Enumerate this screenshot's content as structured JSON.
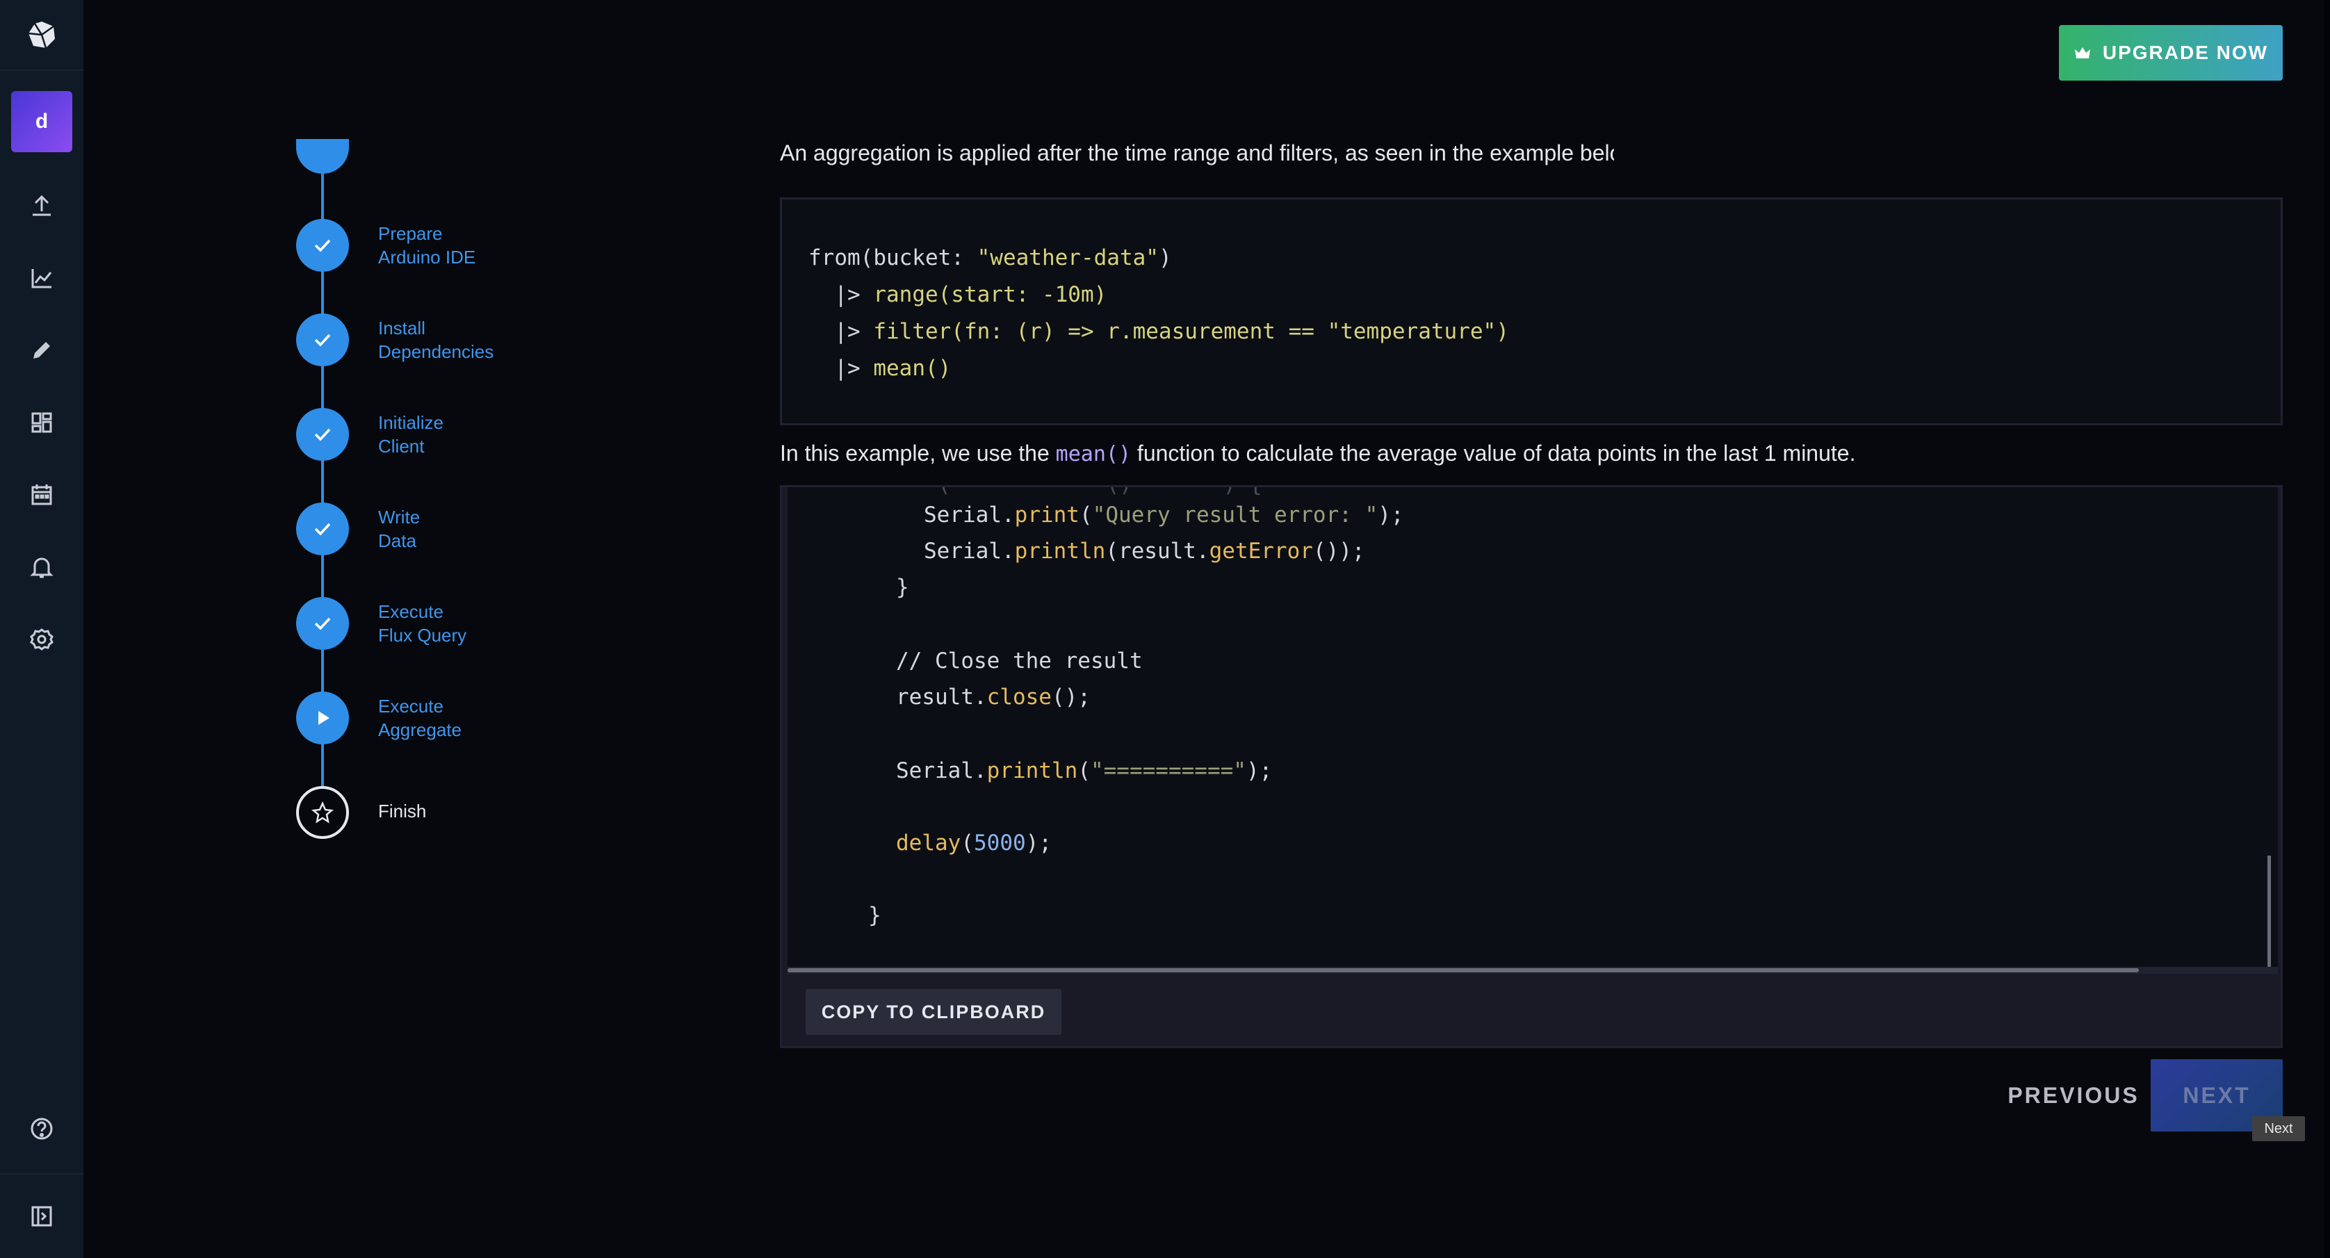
{
  "header": {
    "upgrade_label": "UPGRADE NOW"
  },
  "sidebar": {
    "avatar_letter": "d",
    "items": [
      {
        "icon": "upload-icon"
      },
      {
        "icon": "graph-icon"
      },
      {
        "icon": "pencil-icon"
      },
      {
        "icon": "dashboard-icon"
      },
      {
        "icon": "calendar-icon"
      },
      {
        "icon": "bell-icon"
      },
      {
        "icon": "gear-icon"
      },
      {
        "icon": "help-icon"
      },
      {
        "icon": "collapse-icon"
      }
    ]
  },
  "steps": [
    {
      "line1": "Prepare",
      "line2": "Arduino IDE",
      "status": "done"
    },
    {
      "line1": "Install",
      "line2": "Dependencies",
      "status": "done"
    },
    {
      "line1": "Initialize",
      "line2": "Client",
      "status": "done"
    },
    {
      "line1": "Write",
      "line2": "Data",
      "status": "done"
    },
    {
      "line1": "Execute",
      "line2": "Flux Query",
      "status": "done"
    },
    {
      "line1": "Execute",
      "line2": "Aggregate",
      "status": "current"
    },
    {
      "line1": "Finish",
      "line2": "",
      "status": "pending"
    }
  ],
  "content": {
    "intro_text": "An aggregation is applied after the time range and filters, as seen in the example below.",
    "flux_code": {
      "l1_a": "from(bucket: ",
      "l1_b": "\"weather-data\"",
      "l1_c": ")",
      "l2_a": "  |> ",
      "l2_b": "range(start: -10m)",
      "l3_a": "  |> ",
      "l3_b": "filter(fn: (r) => r.measurement == ",
      "l3_c": "\"temperature\"",
      "l3_d": ")",
      "l4_a": "  |> ",
      "l4_b": "mean()"
    },
    "para_before": "In this example, we use the ",
    "para_code": "mean()",
    "para_after": " function to calculate the average value of data points in the last 1 minute.",
    "arduino_code": {
      "l1_a": "Serial.",
      "l1_b": "print",
      "l1_c": "(",
      "l1_d": "\"Query result error: \"",
      "l1_e": ");",
      "l2_a": "Serial.",
      "l2_b": "println",
      "l2_c": "(result.",
      "l2_d": "getError",
      "l2_e": "());",
      "l3": "}",
      "l4": "// Close the result",
      "l5_a": "result.",
      "l5_b": "close",
      "l5_c": "();",
      "l6_a": "Serial.",
      "l6_b": "println",
      "l6_c": "(",
      "l6_d": "\"==========\"",
      "l6_e": ");",
      "l7_a": "delay",
      "l7_b": "(",
      "l7_c": "5000",
      "l7_d": ");",
      "l8": "}"
    },
    "copy_label": "COPY TO CLIPBOARD"
  },
  "footer": {
    "previous_label": "PREVIOUS",
    "next_label": "NEXT",
    "tooltip": "Next"
  }
}
